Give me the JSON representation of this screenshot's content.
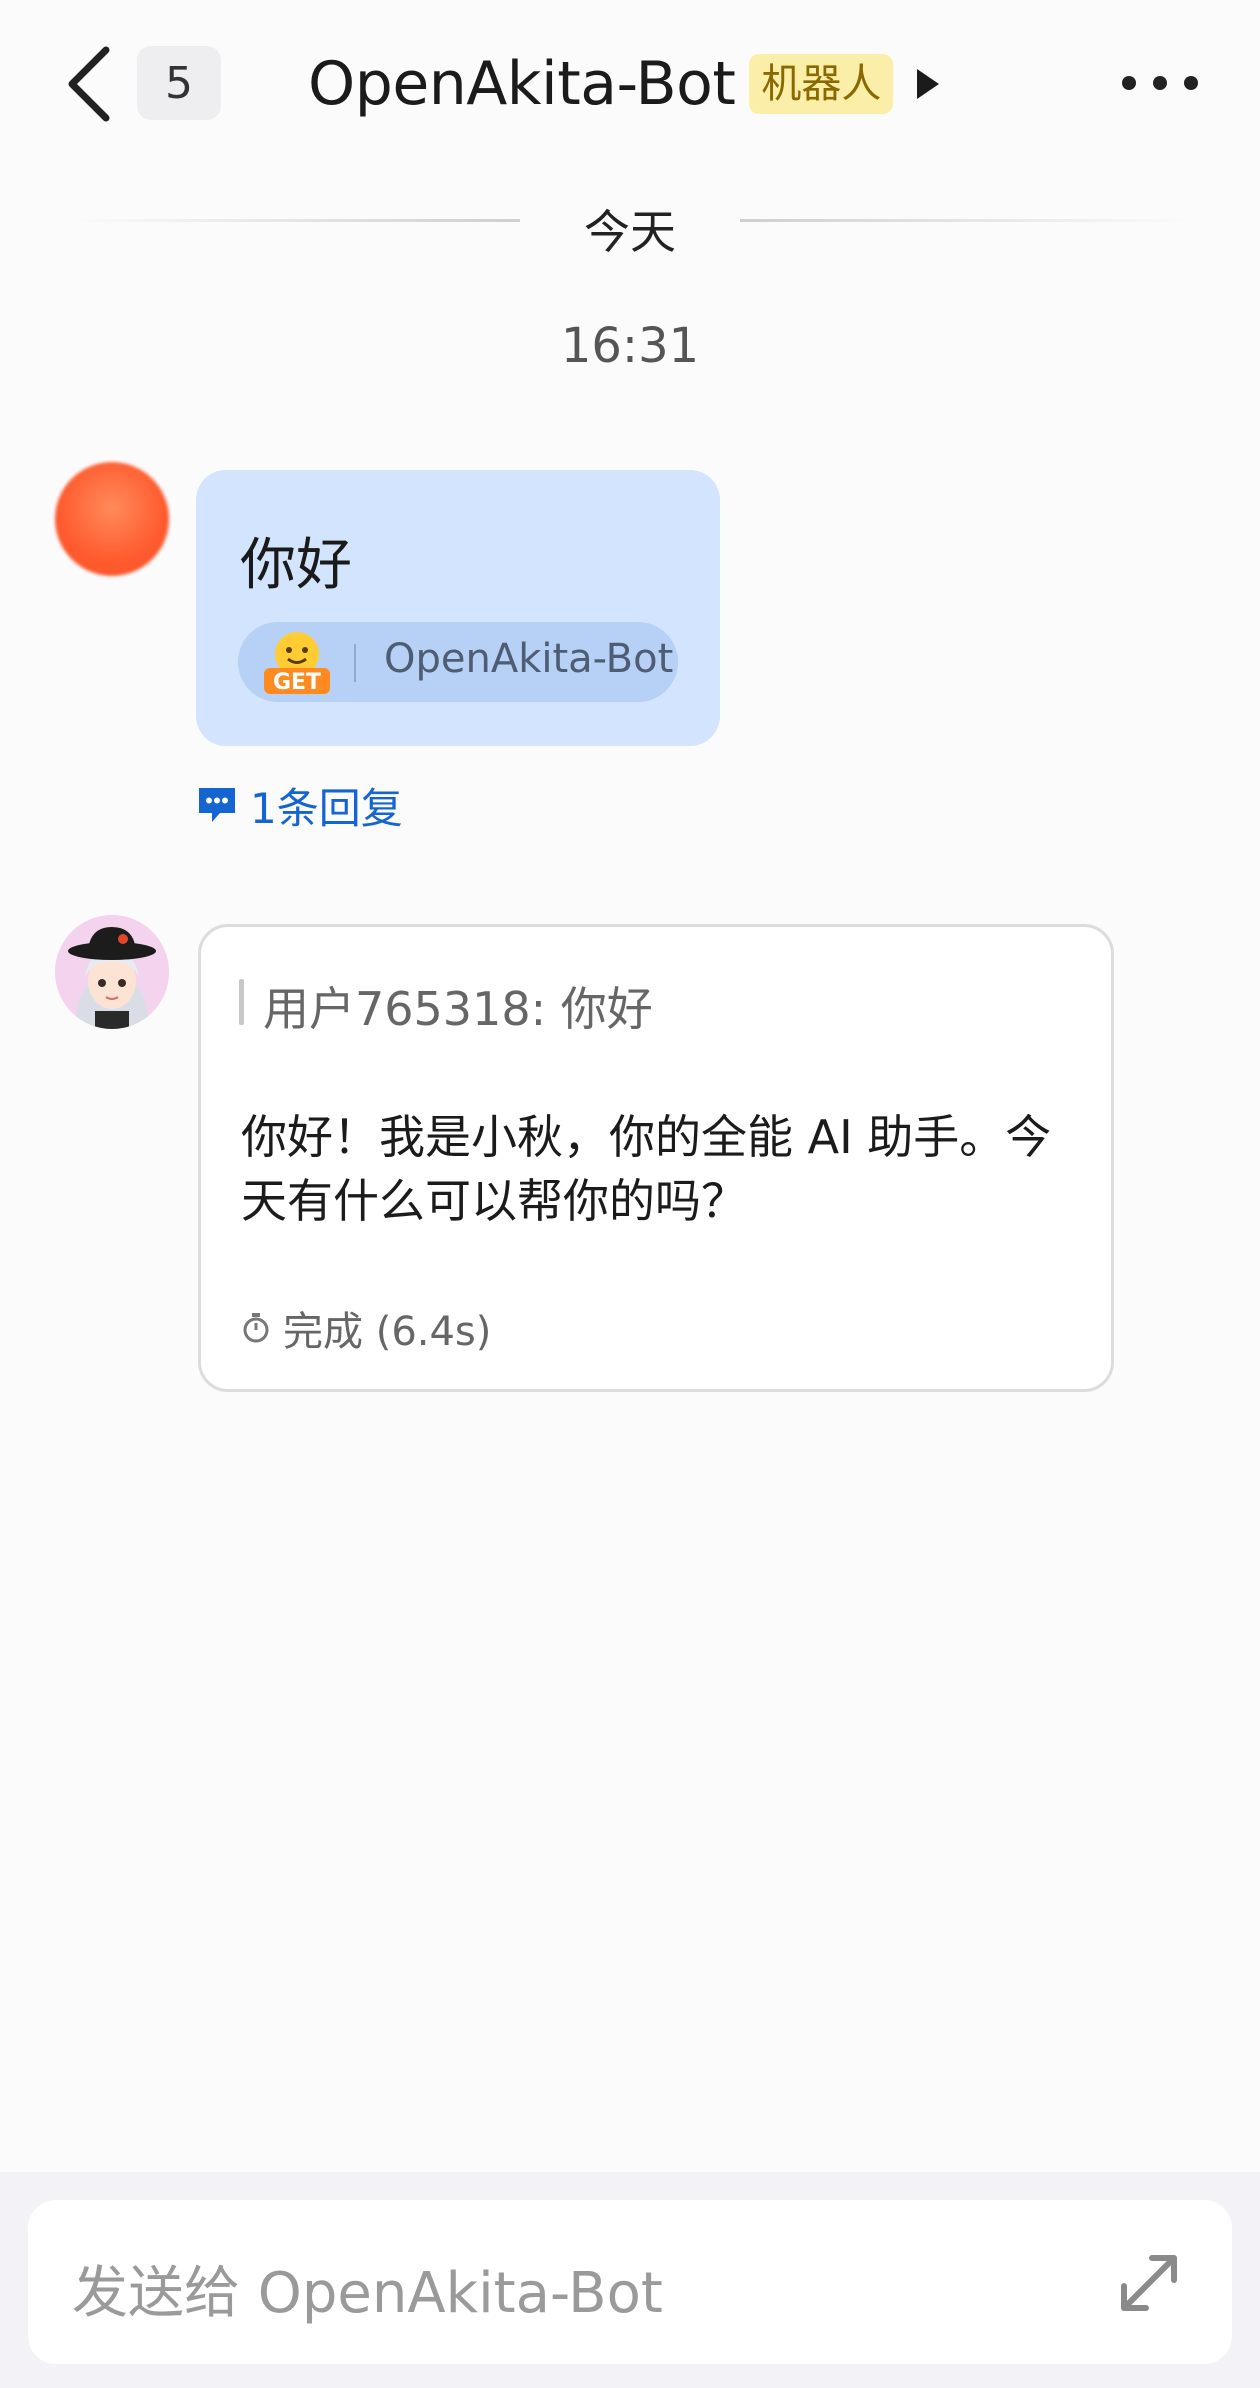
{
  "header": {
    "unread_count": "5",
    "title": "OpenAkita-Bot",
    "bot_tag": "机器人"
  },
  "chat": {
    "date_separator": "今天",
    "time": "16:31",
    "user_message": {
      "text": "你好",
      "bot_chip_name": "OpenAkita-Bot",
      "replies_link": "1条回复"
    },
    "bot_message": {
      "quote": "用户765318: 你好",
      "body": "你好！我是小秋，你的全能 AI 助手。今天有什么可以帮你的吗？",
      "status": "完成 (6.4s)"
    }
  },
  "composer": {
    "placeholder": "发送给 OpenAkita-Bot"
  },
  "colors": {
    "user_bubble": "#d2e4fe",
    "link_blue": "#1465d1",
    "tag_bg": "#fbeea8"
  },
  "icons": [
    "back-arrow-icon",
    "play-triangle-icon",
    "more-dots-icon",
    "get-sticker-icon",
    "comment-icon",
    "timer-icon",
    "expand-icon"
  ]
}
